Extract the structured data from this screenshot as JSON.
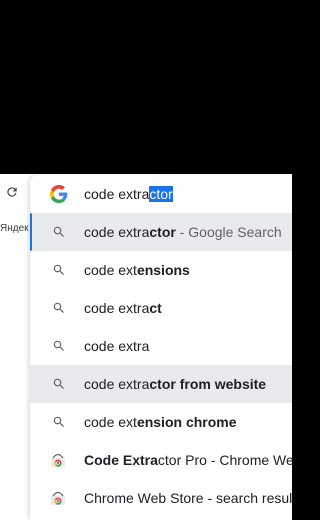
{
  "omnibox": {
    "typed": "code extra",
    "autocomplete": "ctor"
  },
  "page_tab": {
    "label": "Яндек"
  },
  "suggestions": [
    {
      "prefix": "code extra",
      "bold": "ctor",
      "suffix": " - Google Search",
      "icon": "search-icon"
    },
    {
      "prefix": "code ext",
      "bold": "ensions",
      "suffix": "",
      "icon": "search-icon"
    },
    {
      "prefix": "code extra",
      "bold": "ct",
      "suffix": "",
      "icon": "search-icon"
    },
    {
      "prefix": "code extra",
      "bold": "",
      "suffix": "",
      "icon": "search-icon"
    },
    {
      "prefix": "code extra",
      "bold": "ctor from website",
      "suffix": "",
      "icon": "search-icon"
    },
    {
      "prefix": "code ext",
      "bold": "ension chrome",
      "suffix": "",
      "icon": "search-icon"
    },
    {
      "prefix": "",
      "bold": "Code Extra",
      "rest": "ctor Pro - Chrome Web",
      "icon": "chrome-web-store-icon"
    },
    {
      "prefix": "",
      "bold": "",
      "rest": "Chrome Web Store - search results",
      "icon": "chrome-web-store-icon"
    }
  ],
  "colors": {
    "accent": "#1a73e8",
    "hover": "#e8eaed",
    "text": "#202124",
    "secondary": "#5f6368"
  }
}
